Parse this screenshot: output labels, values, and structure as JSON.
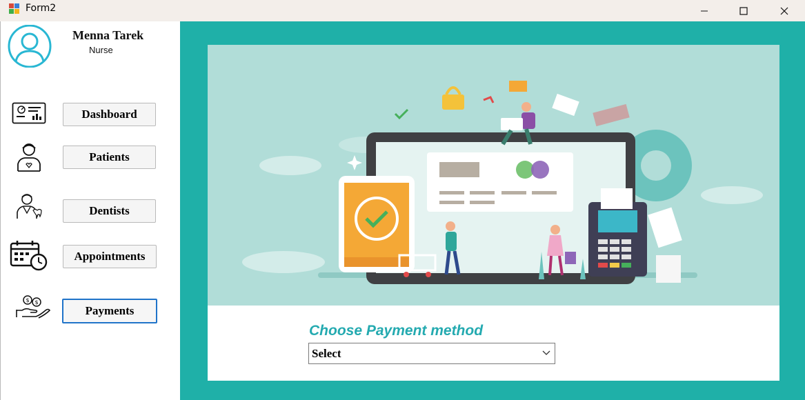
{
  "window": {
    "title": "Form2"
  },
  "user": {
    "name": "Menna Tarek",
    "role": "Nurse"
  },
  "nav": {
    "dashboard": "Dashboard",
    "patients": "Patients",
    "dentists": "Dentists",
    "appointments": "Appointments",
    "payments": "Payments"
  },
  "icons": {
    "avatar": "user-circle-icon",
    "dashboard": "dashboard-monitor-icon",
    "patients": "patient-icon",
    "dentists": "dentist-icon",
    "appointments": "calendar-clock-icon",
    "payments": "hand-coins-icon"
  },
  "payment": {
    "label": "Choose Payment method",
    "selected": "Select"
  },
  "colors": {
    "accent": "#1fb0a8",
    "label": "#24aab0",
    "active_border": "#1f73c9",
    "avatar": "#29b7d3"
  }
}
